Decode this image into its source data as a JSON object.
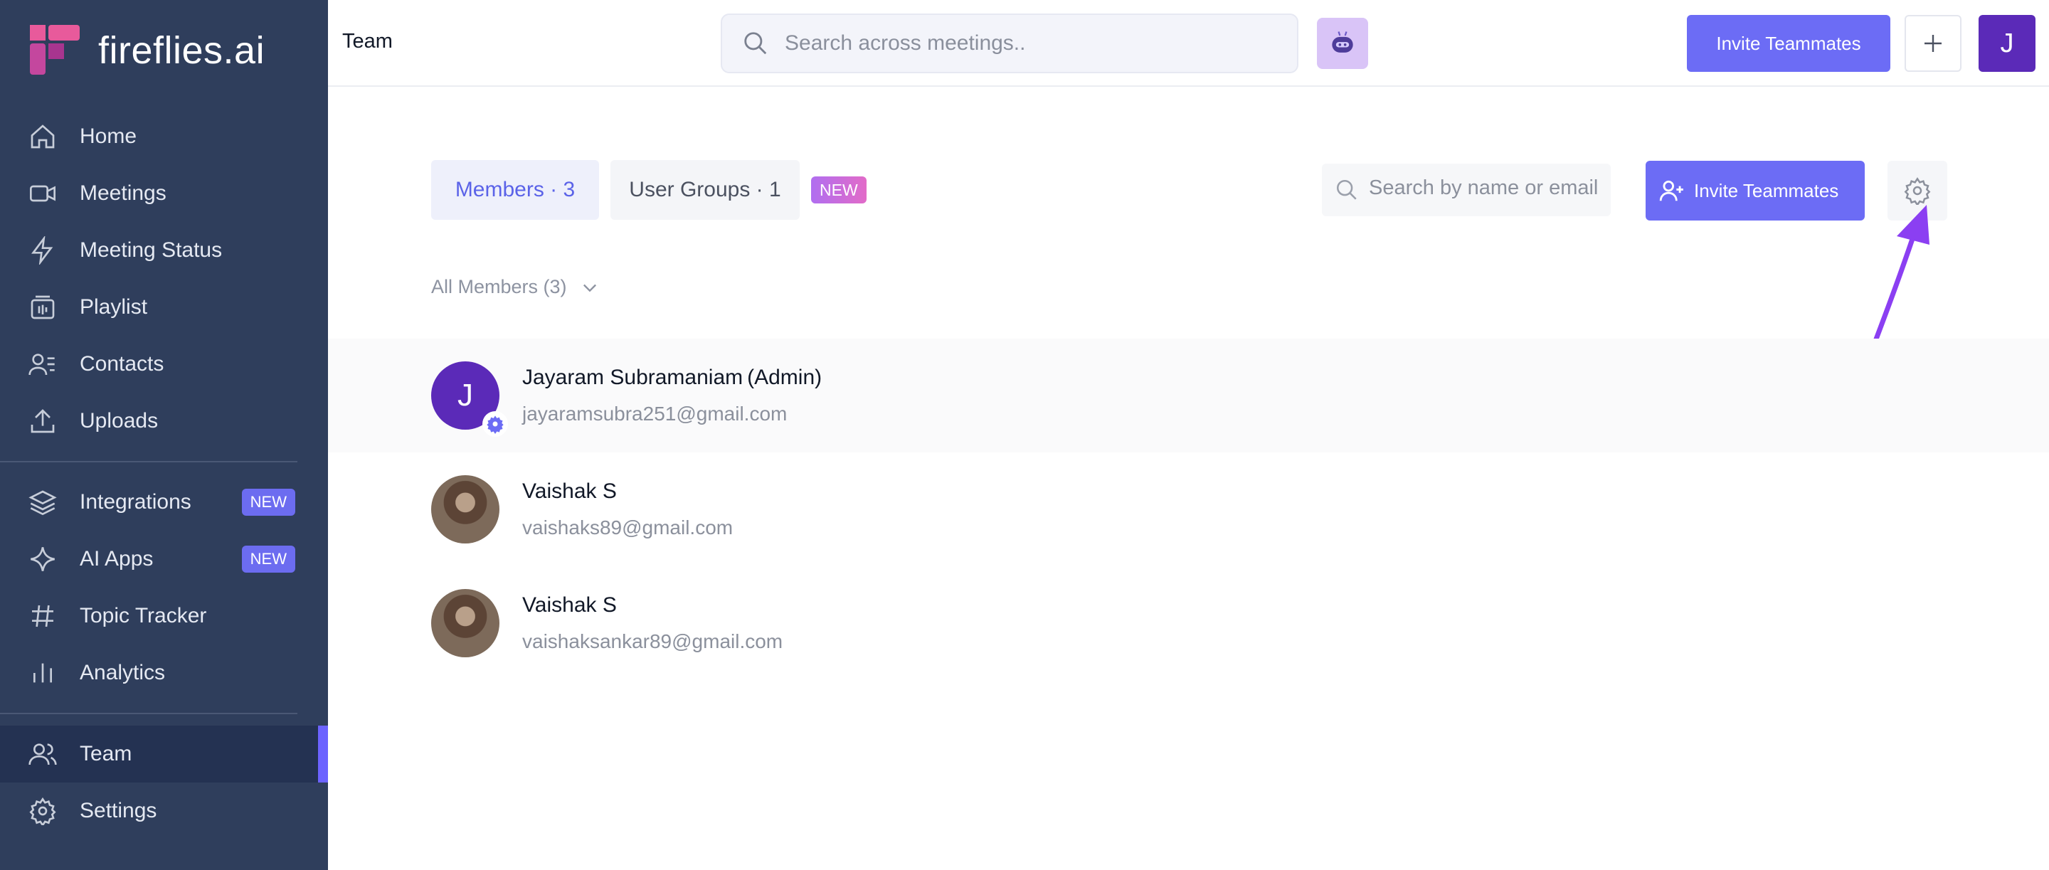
{
  "sidebar": {
    "brand": "fireflies.ai",
    "items": [
      {
        "label": "Home",
        "icon": "home-icon"
      },
      {
        "label": "Meetings",
        "icon": "video-icon"
      },
      {
        "label": "Meeting Status",
        "icon": "lightning-icon"
      },
      {
        "label": "Playlist",
        "icon": "playlist-icon"
      },
      {
        "label": "Contacts",
        "icon": "contacts-icon"
      },
      {
        "label": "Uploads",
        "icon": "upload-icon"
      },
      {
        "label": "Integrations",
        "icon": "layers-icon",
        "badge": "NEW"
      },
      {
        "label": "AI Apps",
        "icon": "sparkle-icon",
        "badge": "NEW"
      },
      {
        "label": "Topic Tracker",
        "icon": "hashtag-icon"
      },
      {
        "label": "Analytics",
        "icon": "bar-chart-icon"
      },
      {
        "label": "Team",
        "icon": "team-icon",
        "active": true
      },
      {
        "label": "Settings",
        "icon": "gear-icon"
      }
    ]
  },
  "header": {
    "title": "Team",
    "search_placeholder": "Search across meetings..",
    "invite_label": "Invite Teammates",
    "avatar_initial": "J"
  },
  "main": {
    "tabs": [
      {
        "label": "Members · 3",
        "active": true
      },
      {
        "label": "User Groups · 1",
        "active": false
      }
    ],
    "new_badge": "NEW",
    "search_placeholder": "Search by name or email",
    "invite_label": "Invite Teammates",
    "filter_label": "All Members (3)",
    "members": [
      {
        "name": "Jayaram Subramaniam",
        "role": "(Admin)",
        "email": "jayaramsubra251@gmail.com",
        "avatar_initial": "J"
      },
      {
        "name": "Vaishak S",
        "role": "",
        "email": "vaishaks89@gmail.com"
      },
      {
        "name": "Vaishak S",
        "role": "",
        "email": "vaishaksankar89@gmail.com"
      }
    ]
  },
  "colors": {
    "sidebar_bg": "#2f3e5c",
    "accent": "#6c6cf5",
    "avatar": "#5b2ab8",
    "annotation_arrow": "#8b3ff2"
  }
}
